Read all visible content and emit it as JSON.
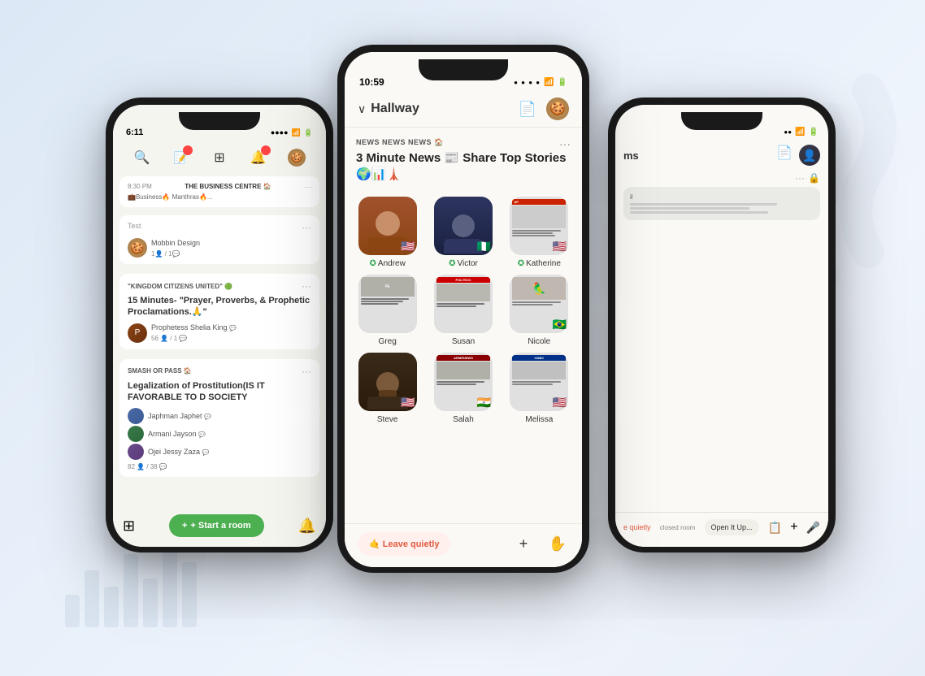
{
  "app": {
    "background_description": "Light blue-white gradient background with decorative sound wave on right and bar chart on bottom left"
  },
  "left_phone": {
    "status_time": "6:11",
    "status_icons": [
      "signal",
      "wifi",
      "battery"
    ],
    "nav_icons": [
      "search",
      "compose",
      "grid",
      "bell",
      "avatar"
    ],
    "room_banner": {
      "time": "8:30 PM",
      "room_name": "THE BUSINESS CENTRE 🏠",
      "description": "💼Business🔥 Manthras🔥..."
    },
    "test_section": {
      "label": "Test",
      "host_name": "Mobbin Design",
      "stats": "1👤 / 1💬"
    },
    "kingdom_section": {
      "label": "\"KINGDOM CITIZENS UNITED\" 🟢",
      "title": "15 Minutes- \"Prayer, Proverbs, & Prophetic Proclamations.🙏\"",
      "host_name": "Prophetess Shelia King",
      "stats": "56👤 / 1💬"
    },
    "smash_section": {
      "label": "SMASH OR PASS 🏠",
      "title": "Legalization of Prostitution(IS IT FAVORABLE TO D SOCIETY",
      "hosts": [
        "Japhman Japhet",
        "Armani Jayson",
        "Ojei Jessy Zaza"
      ],
      "stats": "82👤 / 38💬"
    },
    "start_room_btn": "+ Start a room",
    "bottom_icons": [
      "grid",
      "bell"
    ]
  },
  "center_phone": {
    "status_time": "10:59",
    "status_icons": [
      "signal_dots",
      "wifi",
      "battery"
    ],
    "header_title": "Hallway",
    "header_icons": [
      "document",
      "cookie_avatar"
    ],
    "news_category": "NEWS NEWS NEWS 🏠",
    "news_title": "3 Minute News 📰 Share Top Stories 🌍📊🗼",
    "more_dots": "···",
    "participants": [
      {
        "name": "Andrew",
        "verified": true,
        "flag": "🇺🇸",
        "type": "person",
        "color": "#8B4513"
      },
      {
        "name": "Victor",
        "verified": true,
        "flag": "🇳🇬",
        "type": "person",
        "color": "#2d2d3d"
      },
      {
        "name": "Katherine",
        "verified": true,
        "flag": "🇺🇸",
        "type": "news",
        "color": "#e8e8e8"
      },
      {
        "name": "Greg",
        "verified": false,
        "flag": "",
        "type": "news",
        "color": "#d8d8d0"
      },
      {
        "name": "Susan",
        "verified": false,
        "flag": "",
        "type": "news",
        "color": "#d0d0c8"
      },
      {
        "name": "Nicole",
        "verified": false,
        "flag": "🇧🇷",
        "type": "news",
        "color": "#ddd8d0"
      },
      {
        "name": "Steve",
        "verified": false,
        "flag": "🇺🇸",
        "type": "person",
        "color": "#3a2a1a"
      },
      {
        "name": "Salah",
        "verified": false,
        "flag": "🇮🇳",
        "type": "person",
        "color": "#4a3a2a"
      },
      {
        "name": "Melissa",
        "verified": false,
        "flag": "🇺🇸",
        "type": "news",
        "color": "#d8d8d8"
      }
    ],
    "leave_quietly_btn": "🤙 Leave quietly",
    "bottom_icons": [
      "plus",
      "hand"
    ]
  },
  "right_phone": {
    "status_time": "",
    "header_title": "ms",
    "header_icons": [
      "document",
      "person_avatar"
    ],
    "more_dots": "···",
    "lock_icon": "🔒",
    "closed_room_label": "closed room",
    "open_it_btn": "Open It Up...",
    "leave_quietly_text": "e quietly",
    "bottom_action_icons": [
      "copy",
      "plus",
      "mic"
    ]
  }
}
